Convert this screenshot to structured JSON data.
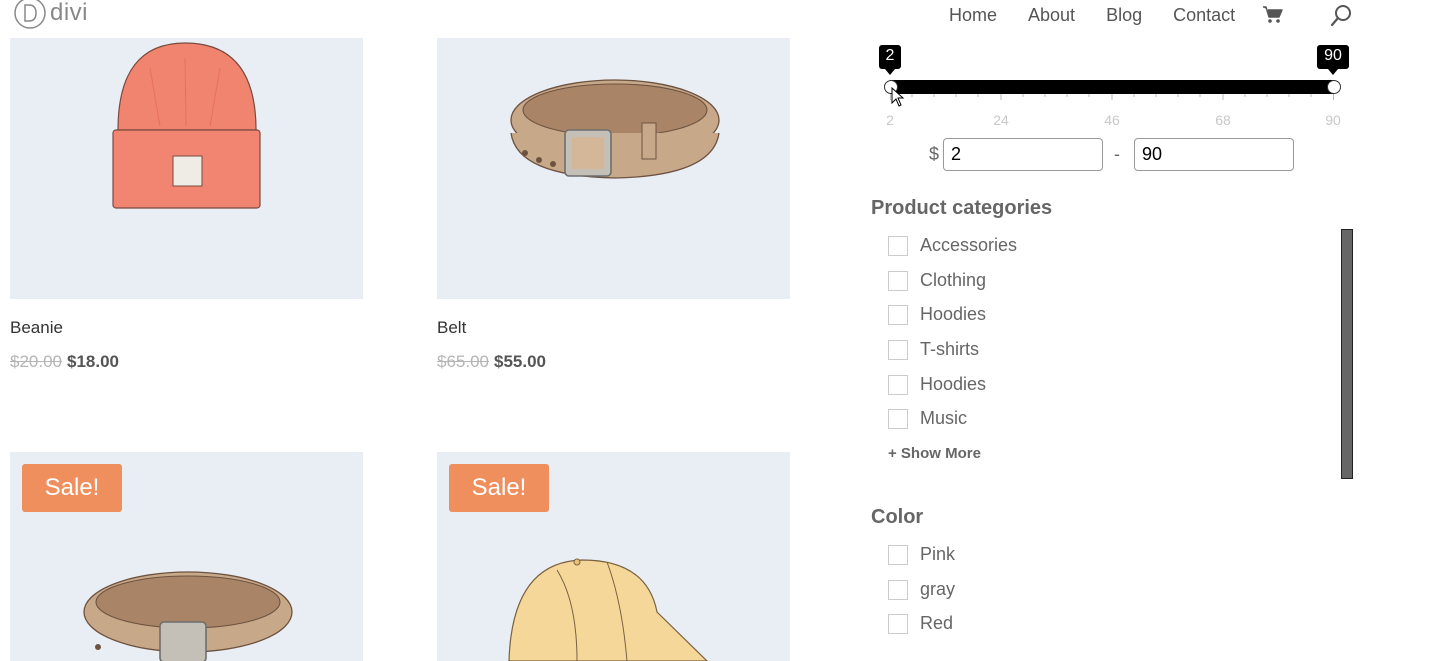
{
  "header": {
    "logo_text": "divi",
    "nav": [
      "Home",
      "About",
      "Blog",
      "Contact"
    ]
  },
  "products": [
    {
      "title": "Beanie",
      "old_price": "$20.00",
      "price": "$18.00"
    },
    {
      "title": "Belt",
      "old_price": "$65.00",
      "price": "$55.00"
    }
  ],
  "sale_badge": "Sale!",
  "price_filter": {
    "min_label": "2",
    "max_label": "90",
    "ticks": [
      "2",
      "24",
      "46",
      "68",
      "90"
    ],
    "currency": "$",
    "min_value": "2",
    "separator": "-",
    "max_value": "90"
  },
  "categories": {
    "title": "Product categories",
    "items": [
      "Accessories",
      "Clothing",
      "Hoodies",
      "T-shirts",
      "Hoodies",
      "Music"
    ],
    "show_more": "+ Show More"
  },
  "colors": {
    "title": "Color",
    "items": [
      "Pink",
      "gray",
      "Red"
    ]
  },
  "theme": {
    "sale_color": "#ef8f5e",
    "image_bg": "#e8eef4"
  }
}
